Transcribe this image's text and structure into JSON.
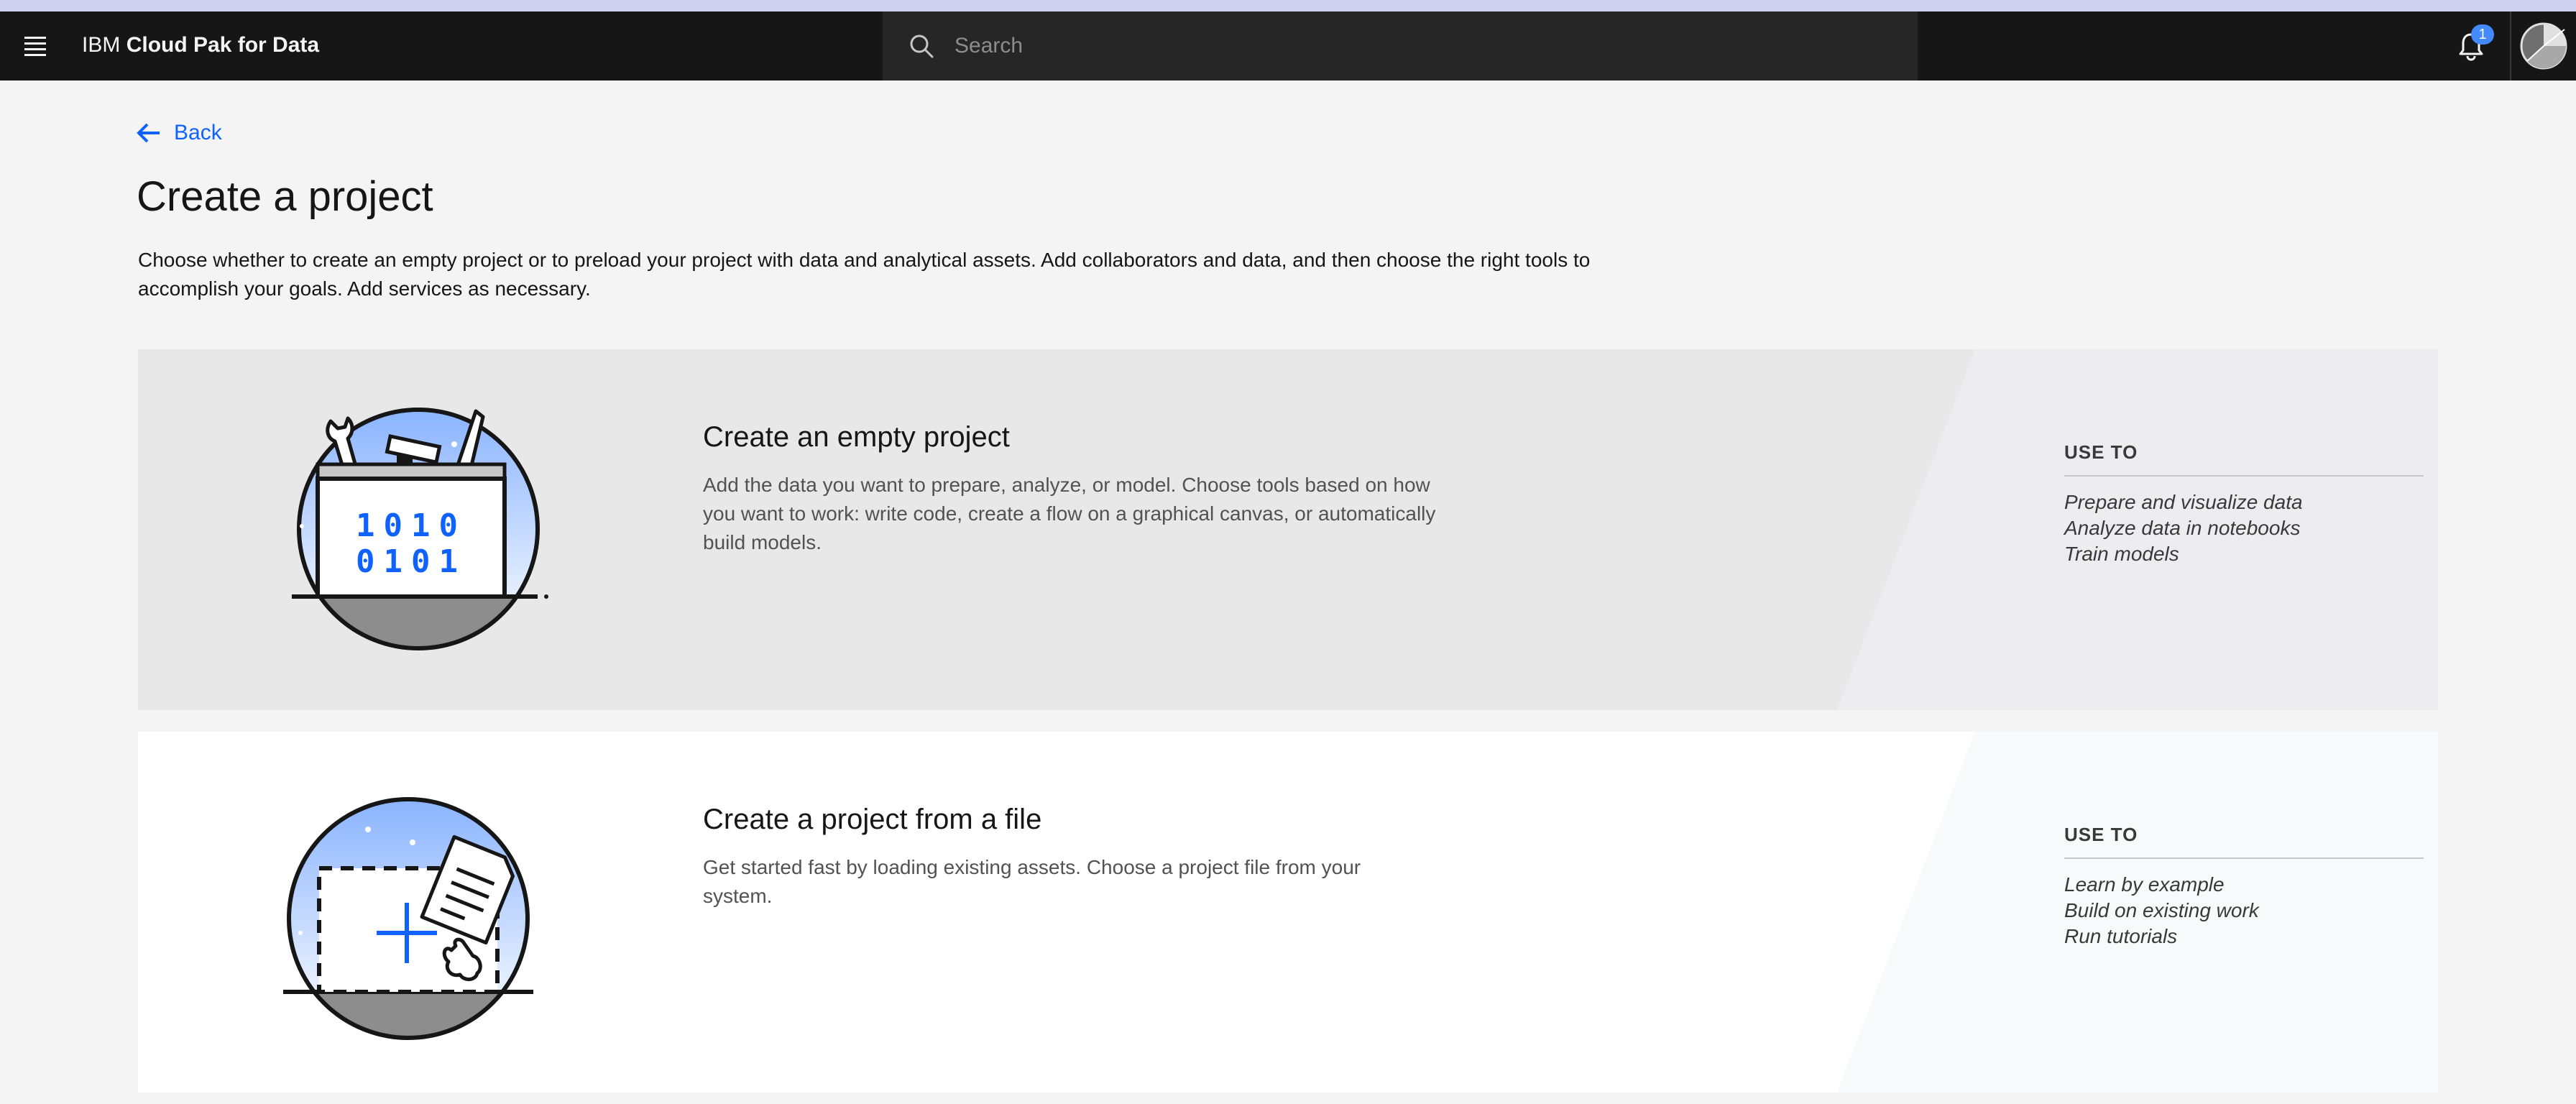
{
  "header": {
    "brand_prefix": "IBM",
    "brand_name": "Cloud Pak for Data",
    "search_placeholder": "Search",
    "notification_count": "1",
    "menu_icon": "hamburger-menu-icon",
    "search_icon": "search-icon",
    "bell_icon": "bell-icon",
    "avatar_icon": "user-avatar-icon"
  },
  "nav": {
    "back_label": "Back"
  },
  "page": {
    "title": "Create a project",
    "description": "Choose whether to create an empty project or to preload your project with data and analytical assets. Add collaborators and data, and then choose the right tools to accomplish your goals. Add services as necessary."
  },
  "cards": [
    {
      "title": "Create an empty project",
      "body": "Add the data you want to prepare, analyze, or model. Choose tools based on how you want to work: write code, create a flow on a graphical canvas, or automatically build models.",
      "use_to_heading": "USE TO",
      "use_to": [
        "Prepare and visualize data",
        "Analyze data in notebooks",
        "Train models"
      ],
      "illustration_text": [
        "1010",
        "0101"
      ]
    },
    {
      "title": "Create a project from a file",
      "body": "Get started fast by loading existing assets. Choose a project file from your system.",
      "use_to_heading": "USE TO",
      "use_to": [
        "Learn by example",
        "Build on existing work",
        "Run tutorials"
      ]
    }
  ],
  "colors": {
    "accent": "#0f62fe",
    "header_bg": "#161616",
    "badge": "#4589ff"
  }
}
